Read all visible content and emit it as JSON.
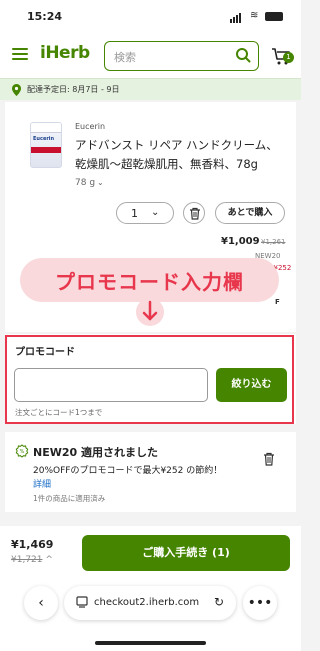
{
  "status_bar": {
    "time": "15:24"
  },
  "header": {
    "logo": "iHerb",
    "search_placeholder": "検索",
    "cart_count": "1"
  },
  "delivery": {
    "text": "配達予定日: 8月7日 - 9日"
  },
  "product": {
    "brand": "Eucerin",
    "image_label": "Eucerin",
    "title": "アドバンスト リペア ハンドクリーム、乾燥肌〜超乾燥肌用、無香料、78g",
    "size": "78 g",
    "quantity": "1",
    "save_later_label": "あとで購入",
    "price": "¥1,009",
    "list_price": "¥1,261",
    "promo_hint": "NEW20",
    "promo_saving": "-¥252",
    "extra_letter": "F"
  },
  "annotation": {
    "label": "プロモコード入力欄"
  },
  "promo": {
    "title": "プロモコード",
    "input_value": "",
    "apply_label": "絞り込む",
    "note": "注文ごとにコード1つまで"
  },
  "applied_promo": {
    "heading": "NEW20 適用されました",
    "description": "20%OFFのプロモコードで最大¥252 の節約！",
    "details_link": "詳細",
    "note": "1件の商品に適用済み"
  },
  "checkout_bar": {
    "total": "¥1,469",
    "original_total": "¥1,721",
    "checkout_label": "ご購入手続き (1)"
  },
  "browser": {
    "url": "checkout2.iherb.com"
  },
  "colors": {
    "brand_green": "#458500",
    "highlight_red": "#e8364c"
  }
}
